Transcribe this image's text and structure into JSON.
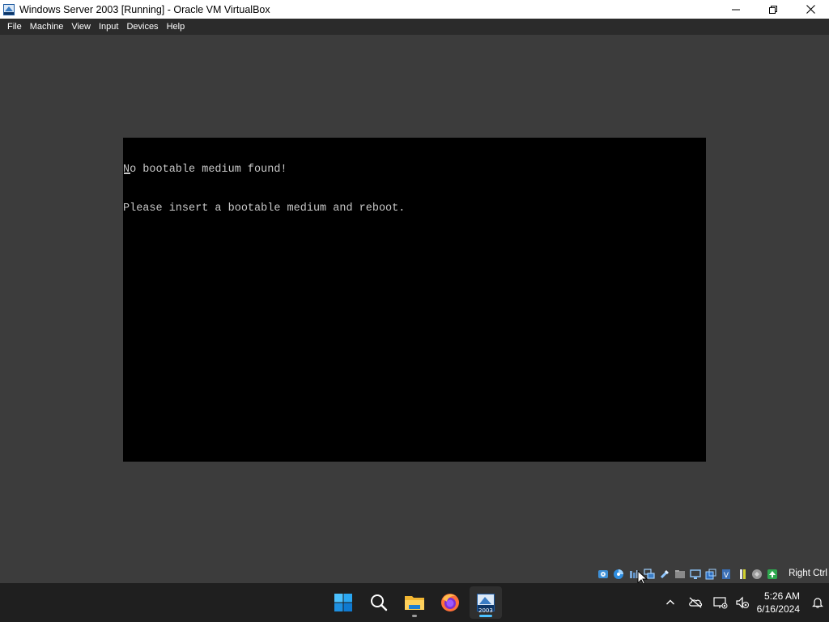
{
  "window": {
    "title": "Windows Server 2003 [Running] - Oracle VM VirtualBox",
    "app_icon": "virtualbox-vm-icon"
  },
  "menu": {
    "items": [
      "File",
      "Machine",
      "View",
      "Input",
      "Devices",
      "Help"
    ]
  },
  "vm_console": {
    "lines": [
      "No bootable medium found!",
      "Please insert a bootable medium and reboot."
    ]
  },
  "status_bar": {
    "icons": [
      "hard-disk-icon",
      "optical-drive-icon",
      "audio-icon",
      "network-icon",
      "usb-icon",
      "shared-folders-icon",
      "display-icon",
      "video-capture-icon",
      "vt-x-icon",
      "cpu-icon",
      "mouse-integration-icon"
    ],
    "host_key": "Right Ctrl"
  },
  "taskbar": {
    "apps": [
      {
        "name": "start-button-icon",
        "label": "Start"
      },
      {
        "name": "search-icon",
        "label": "Search"
      },
      {
        "name": "file-explorer-icon",
        "label": "File Explorer"
      },
      {
        "name": "firefox-icon",
        "label": "Firefox"
      },
      {
        "name": "virtualbox-vm-icon",
        "label": "2003"
      }
    ],
    "vm_badge": "2003",
    "clock": {
      "time": "5:26 AM",
      "date": "6/16/2024"
    }
  },
  "colors": {
    "vm_background": "#3c3c3c",
    "console_text": "#c8c8c8",
    "taskbar": "#1f1f1f",
    "accent": "#4cc2ff"
  }
}
